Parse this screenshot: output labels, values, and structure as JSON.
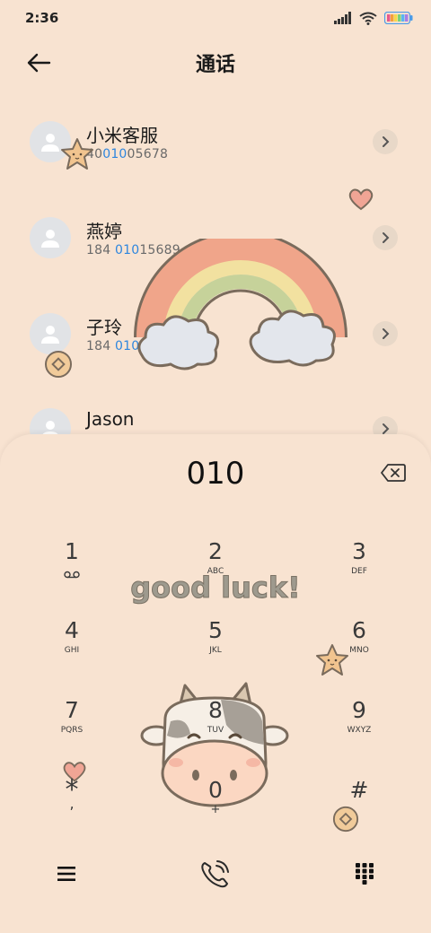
{
  "status": {
    "time": "2:36"
  },
  "header": {
    "title": "通话"
  },
  "contacts": [
    {
      "name": "小米客服",
      "num_pre": "40",
      "num_hl": "010",
      "num_post": "05678"
    },
    {
      "name": "燕婷",
      "num_pre": "184 ",
      "num_hl": "010",
      "num_post": "15689"
    },
    {
      "name": "子玲",
      "num_pre": "184 ",
      "num_hl": "0101",
      "num_post": " 5678"
    },
    {
      "name": "Jason",
      "num_pre": "",
      "num_hl": "",
      "num_post": ""
    }
  ],
  "dialpad": {
    "number": "010",
    "keys": [
      {
        "digit": "1",
        "letters": ""
      },
      {
        "digit": "2",
        "letters": "ABC"
      },
      {
        "digit": "3",
        "letters": "DEF"
      },
      {
        "digit": "4",
        "letters": "GHI"
      },
      {
        "digit": "5",
        "letters": "JKL"
      },
      {
        "digit": "6",
        "letters": "MNO"
      },
      {
        "digit": "7",
        "letters": "PQRS"
      },
      {
        "digit": "8",
        "letters": "TUV"
      },
      {
        "digit": "9",
        "letters": "WXYZ"
      },
      {
        "digit": "*",
        "letters": ","
      },
      {
        "digit": "0",
        "letters": "+"
      },
      {
        "digit": "#",
        "letters": ""
      }
    ]
  },
  "decor": {
    "good_luck": "good luck!"
  },
  "icons": [
    "back-arrow-icon",
    "chevron-right-icon",
    "backspace-icon",
    "voicemail-icon",
    "menu-icon",
    "call-icon",
    "keypad-icon"
  ],
  "colors": {
    "background": "#f8e3d1",
    "highlight": "#2e86de"
  }
}
